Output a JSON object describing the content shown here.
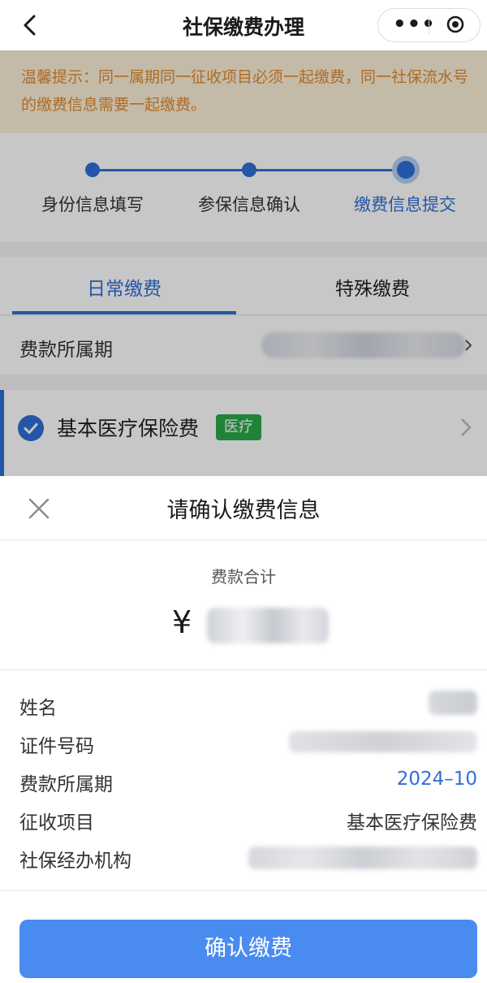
{
  "header": {
    "title": "社保缴费办理",
    "back_icon": "chevron-left-icon",
    "more_icon": "more-dots-icon",
    "close_icon": "target-circle-icon"
  },
  "notice": {
    "text": "温馨提示：同一属期同一征收项目必须一起缴费，同一社保流水号的缴费信息需要一起缴费。"
  },
  "steps": [
    {
      "label": "身份信息填写",
      "state": "done"
    },
    {
      "label": "参保信息确认",
      "state": "done"
    },
    {
      "label": "缴费信息提交",
      "state": "active"
    }
  ],
  "tabs": [
    {
      "label": "日常缴费",
      "active": true
    },
    {
      "label": "特殊缴费",
      "active": false
    }
  ],
  "period_row": {
    "label": "费款所属期"
  },
  "insurance_item": {
    "label": "基本医疗保险费",
    "tag": "医疗",
    "checked": true
  },
  "sheet": {
    "title": "请确认缴费信息",
    "total_label": "费款合计",
    "currency": "¥",
    "rows": [
      {
        "label": "姓名",
        "value": ""
      },
      {
        "label": "证件号码",
        "value": ""
      },
      {
        "label": "费款所属期",
        "value": "2024–10"
      },
      {
        "label": "征收项目",
        "value": "基本医疗保险费"
      },
      {
        "label": "社保经办机构",
        "value": ""
      }
    ],
    "confirm_label": "确认缴费"
  },
  "colors": {
    "accent": "#2f6fd8",
    "button": "#4a8bef",
    "notice_text": "#e08a2e",
    "notice_bg": "#fbefd8",
    "tag_bg": "#2aa84a"
  }
}
